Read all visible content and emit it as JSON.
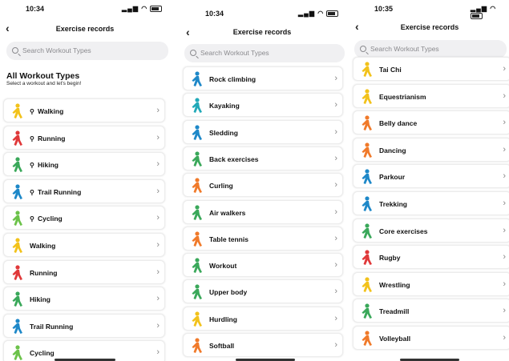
{
  "screens": [
    {
      "time": "10:34",
      "title": "Exercise records",
      "back": "‹",
      "search_placeholder": "Search Workout Types",
      "section_title": "All Workout Types",
      "section_subtitle": "Select a workout and let's begin!",
      "items": [
        {
          "label": "Walking",
          "pin": true,
          "color": "#f2c21b",
          "icon": "walking-icon"
        },
        {
          "label": "Running",
          "pin": true,
          "color": "#e0393a",
          "icon": "running-icon"
        },
        {
          "label": "Hiking",
          "pin": true,
          "color": "#3aa85a",
          "icon": "hiking-icon"
        },
        {
          "label": "Trail Running",
          "pin": true,
          "color": "#1e88c8",
          "icon": "trail-running-icon"
        },
        {
          "label": "Cycling",
          "pin": true,
          "color": "#6cc24a",
          "icon": "cycling-icon"
        },
        {
          "label": "Walking",
          "pin": false,
          "color": "#f2c21b",
          "icon": "walking-icon"
        },
        {
          "label": "Running",
          "pin": false,
          "color": "#e0393a",
          "icon": "running-icon"
        },
        {
          "label": "Hiking",
          "pin": false,
          "color": "#3aa85a",
          "icon": "hiking-icon"
        },
        {
          "label": "Trail Running",
          "pin": false,
          "color": "#1e88c8",
          "icon": "trail-running-icon"
        },
        {
          "label": "Cycling",
          "pin": false,
          "color": "#6cc24a",
          "icon": "cycling-icon"
        }
      ]
    },
    {
      "time": "10:34",
      "title": "Exercise records",
      "back": "‹",
      "search_placeholder": "Search Workout Types",
      "items": [
        {
          "label": "Rock climbing",
          "color": "#1e88c8",
          "icon": "rock-climbing-icon"
        },
        {
          "label": "Kayaking",
          "color": "#21a9b8",
          "icon": "kayaking-icon"
        },
        {
          "label": "Sledding",
          "color": "#1e88c8",
          "icon": "sledding-icon"
        },
        {
          "label": "Back exercises",
          "color": "#3aa85a",
          "icon": "back-exercises-icon"
        },
        {
          "label": "Curling",
          "color": "#f07a2a",
          "icon": "curling-icon"
        },
        {
          "label": "Air walkers",
          "color": "#3aa85a",
          "icon": "air-walkers-icon"
        },
        {
          "label": "Table tennis",
          "color": "#f07a2a",
          "icon": "table-tennis-icon"
        },
        {
          "label": "Workout",
          "color": "#3aa85a",
          "icon": "workout-icon"
        },
        {
          "label": "Upper body",
          "color": "#3aa85a",
          "icon": "upper-body-icon"
        },
        {
          "label": "Hurdling",
          "color": "#f2c21b",
          "icon": "hurdling-icon"
        },
        {
          "label": "Softball",
          "color": "#f07a2a",
          "icon": "softball-icon"
        }
      ]
    },
    {
      "time": "10:35",
      "title": "Exercise records",
      "back": "‹",
      "search_placeholder": "Search Workout Types",
      "items": [
        {
          "label": "Tai Chi",
          "color": "#f2c21b",
          "icon": "tai-chi-icon"
        },
        {
          "label": "Equestrianism",
          "color": "#f2c21b",
          "icon": "equestrianism-icon"
        },
        {
          "label": "Belly dance",
          "color": "#f07a2a",
          "icon": "belly-dance-icon"
        },
        {
          "label": "Dancing",
          "color": "#f07a2a",
          "icon": "dancing-icon"
        },
        {
          "label": "Parkour",
          "color": "#1e88c8",
          "icon": "parkour-icon"
        },
        {
          "label": "Trekking",
          "color": "#1e88c8",
          "icon": "trekking-icon"
        },
        {
          "label": "Core exercises",
          "color": "#3aa85a",
          "icon": "core-exercises-icon"
        },
        {
          "label": "Rugby",
          "color": "#e0393a",
          "icon": "rugby-icon"
        },
        {
          "label": "Wrestling",
          "color": "#f2c21b",
          "icon": "wrestling-icon"
        },
        {
          "label": "Treadmill",
          "color": "#3aa85a",
          "icon": "treadmill-icon"
        },
        {
          "label": "Volleyball",
          "color": "#f07a2a",
          "icon": "volleyball-icon"
        }
      ]
    }
  ]
}
